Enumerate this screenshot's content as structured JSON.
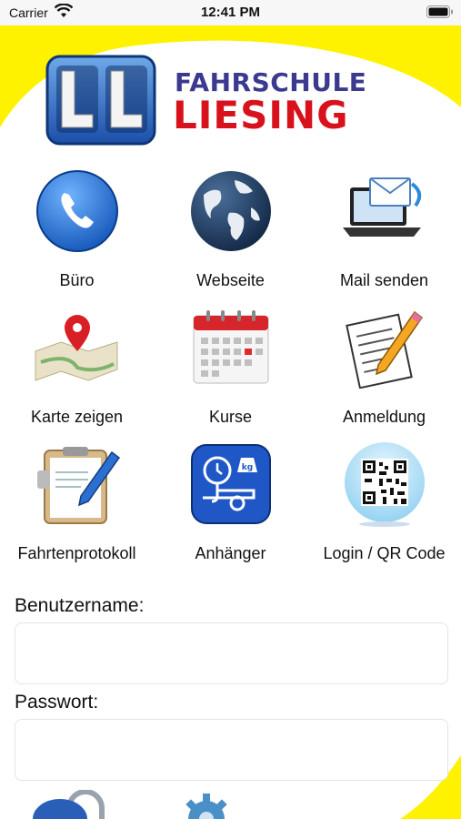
{
  "status": {
    "carrier": "Carrier",
    "time": "12:41 PM"
  },
  "logo": {
    "line1": "FAHRSCHULE",
    "line2": "LIESING",
    "cube_letters": "LL"
  },
  "colors": {
    "accent_yellow": "#fff200",
    "brand_blue": "#3c3a8f",
    "brand_red": "#d8121c"
  },
  "tiles": [
    {
      "label": "Büro",
      "icon": "phone-icon"
    },
    {
      "label": "Webseite",
      "icon": "globe-icon"
    },
    {
      "label": "Mail senden",
      "icon": "laptop-mail-icon"
    },
    {
      "label": "Karte zeigen",
      "icon": "map-pin-icon"
    },
    {
      "label": "Kurse",
      "icon": "calendar-icon"
    },
    {
      "label": "Anmeldung",
      "icon": "form-pencil-icon"
    },
    {
      "label": "Fahrtenprotokoll",
      "icon": "clipboard-icon"
    },
    {
      "label": "Anhänger",
      "icon": "trailer-icon"
    },
    {
      "label": "Login / QR Code",
      "icon": "qr-code-icon"
    }
  ],
  "form": {
    "username_label": "Benutzername:",
    "username_value": "",
    "password_label": "Passwort:",
    "password_value": ""
  }
}
